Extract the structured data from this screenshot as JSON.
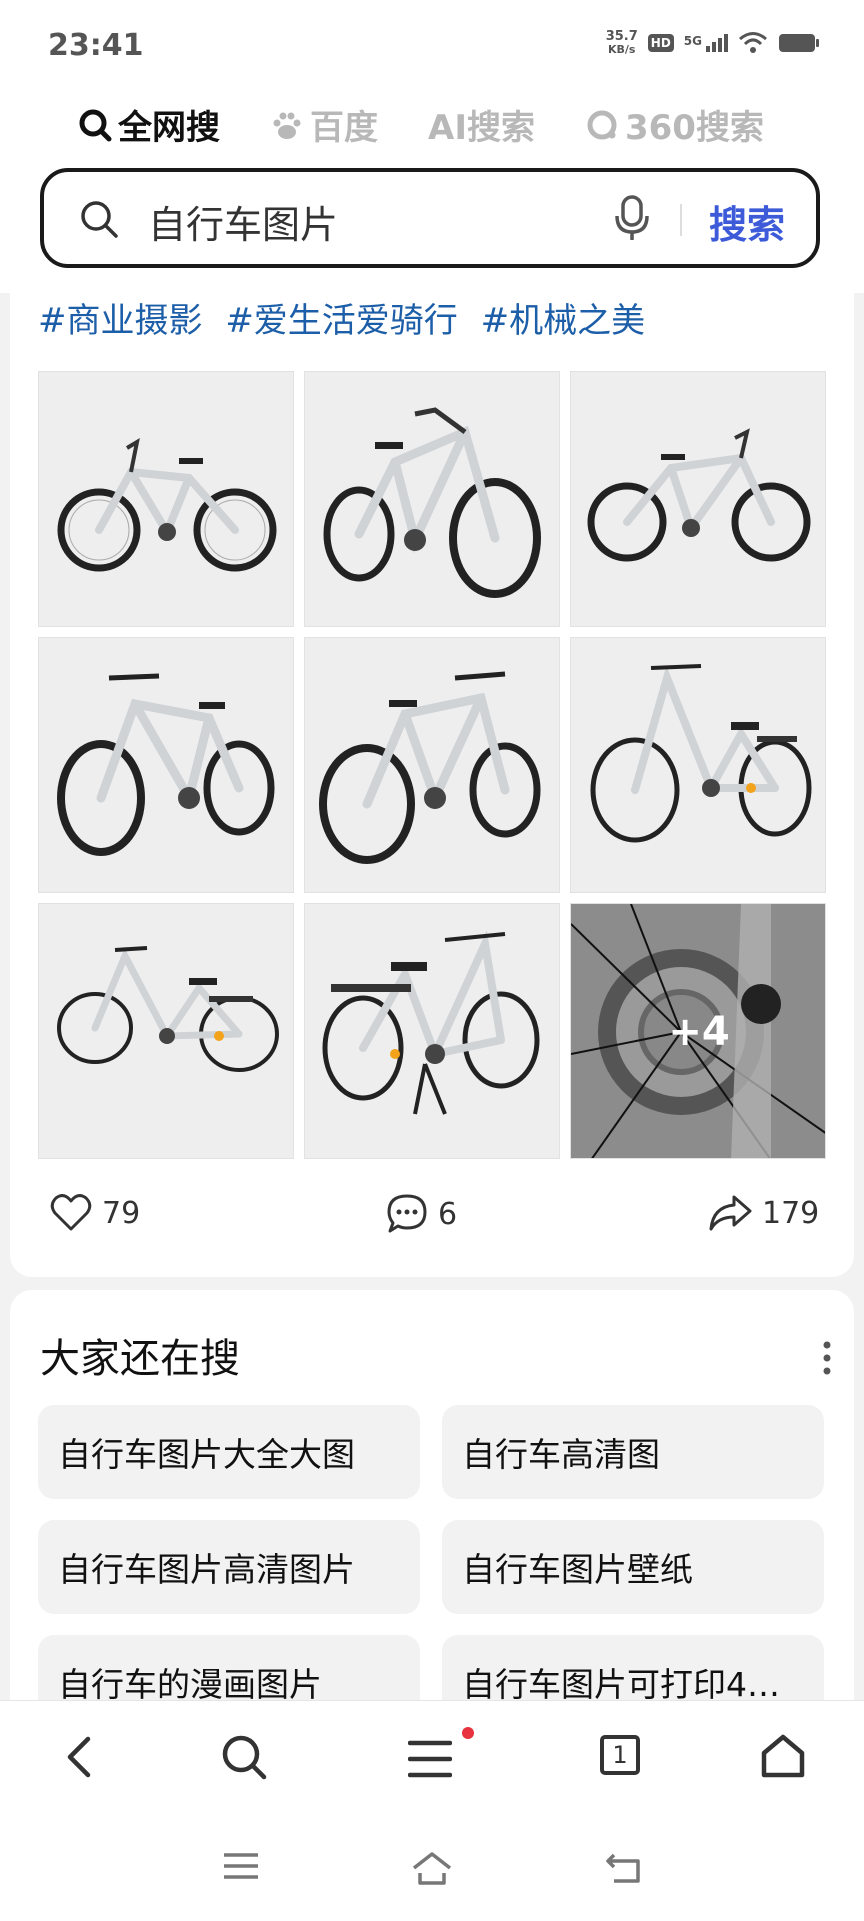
{
  "status_bar": {
    "time": "23:41",
    "net_speed_value": "35.7",
    "net_speed_unit": "KB/s",
    "hd_badge": "HD",
    "network": "5G"
  },
  "search_tabs": [
    {
      "label": "全网搜",
      "icon": "search-icon",
      "active": true
    },
    {
      "label": "百度",
      "icon": "paw-icon",
      "active": false
    },
    {
      "label": "AI搜索",
      "icon": "",
      "active": false
    },
    {
      "label": "360搜索",
      "icon": "360-logo-icon",
      "active": false
    }
  ],
  "search": {
    "query": "自行车图片",
    "submit_label": "搜索"
  },
  "post": {
    "tags": [
      "#商业摄影",
      "#爱生活爱骑行",
      "#机械之美"
    ],
    "more_images_label": "+4",
    "likes": "79",
    "comments": "6",
    "shares": "179"
  },
  "related": {
    "title": "大家还在搜",
    "items": [
      "自行车图片大全大图",
      "自行车高清图",
      "自行车图片高清图片",
      "自行车图片壁纸",
      "自行车的漫画图片",
      "自行车图片可打印4…"
    ]
  },
  "bottom_nav": {
    "tab_count": "1"
  },
  "colors": {
    "accent": "#3d5bd8",
    "tag": "#1c5ea8",
    "notification": "#e8323c"
  }
}
